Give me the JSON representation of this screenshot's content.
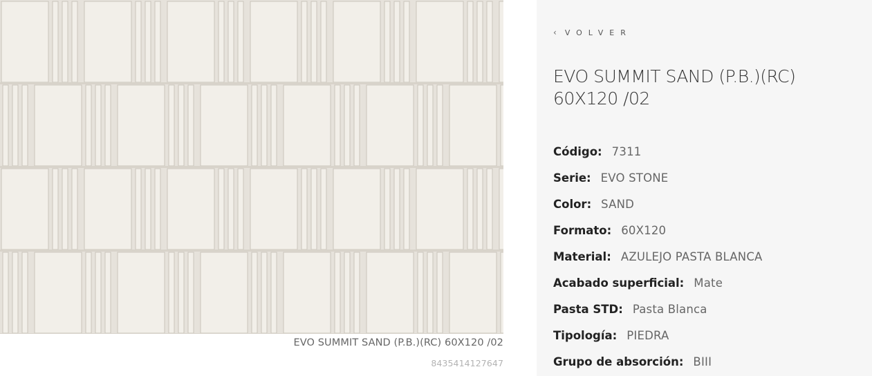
{
  "image": {
    "alt": "Tile image",
    "colors": {
      "base": "#e6e2db",
      "highlight": "#f2efe9",
      "shadow": "#c9c4bb",
      "groove": "#d8d3ca"
    }
  },
  "caption": {
    "product_name": "EVO SUMMIT SAND (P.B.)(RC) 60X120 /02",
    "ean": "8435414127647"
  },
  "panel": {
    "back_chevron": "‹",
    "back_label": "VOLVER",
    "title": "EVO SUMMIT SAND (P.B.)(RC) 60X120 /02",
    "specs": [
      {
        "key": "Código:",
        "value": "7311"
      },
      {
        "key": "Serie:",
        "value": "EVO STONE"
      },
      {
        "key": "Color:",
        "value": "SAND"
      },
      {
        "key": "Formato:",
        "value": "60X120"
      },
      {
        "key": "Material:",
        "value": "AZULEJO PASTA BLANCA"
      },
      {
        "key": "Acabado superficial:",
        "value": "Mate"
      },
      {
        "key": "Pasta STD:",
        "value": "Pasta Blanca"
      },
      {
        "key": "Tipología:",
        "value": "PIEDRA"
      },
      {
        "key": "Grupo de absorción:",
        "value": "BIII"
      }
    ]
  }
}
